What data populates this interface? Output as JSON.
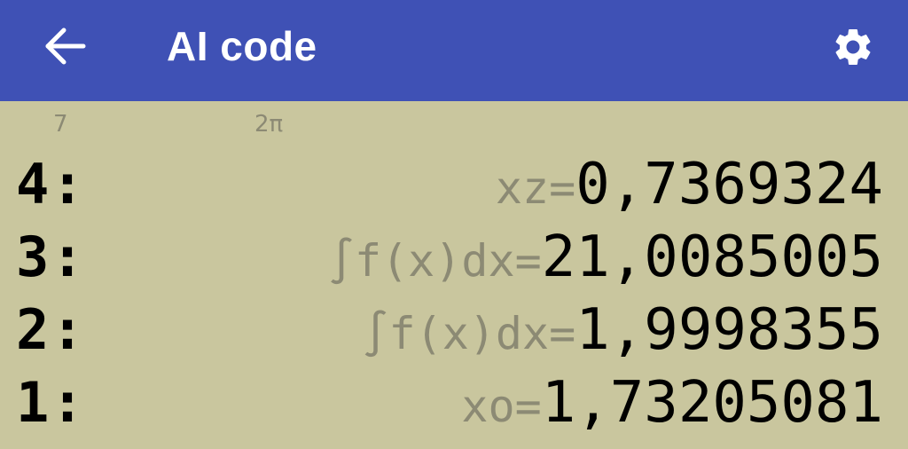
{
  "appbar": {
    "title": "AI code",
    "back_icon": "arrow-left-icon",
    "settings_icon": "gear-icon",
    "background_color": "#3f51b5"
  },
  "hints": {
    "left": "7",
    "right": "2π"
  },
  "stack": [
    {
      "index": "4:",
      "label": "xz=",
      "value": "0,7369324"
    },
    {
      "index": "3:",
      "label": "∫f(x)dx=",
      "value": "21,0085005"
    },
    {
      "index": "2:",
      "label": "∫f(x)dx=",
      "value": "1,9998355"
    },
    {
      "index": "1:",
      "label": "xo=",
      "value": "1,73205081"
    }
  ],
  "display_background_color": "#c9c69e"
}
